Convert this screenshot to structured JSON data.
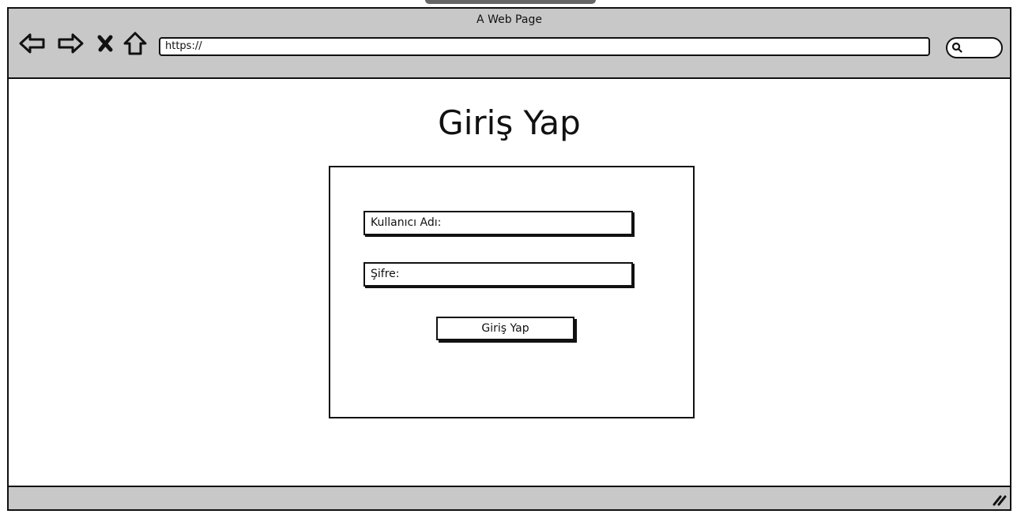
{
  "window": {
    "title": "A Web Page"
  },
  "toolbar": {
    "icons": [
      "back-arrow-icon",
      "forward-arrow-icon",
      "close-x-icon",
      "home-icon"
    ],
    "url": "https://",
    "search_icon": "search-icon"
  },
  "page": {
    "heading": "Giriş Yap"
  },
  "login_form": {
    "username_label": "Kullanıcı Adı:",
    "password_label": "Şifre:",
    "submit_label": "Giriş Yap"
  },
  "statusbar": {
    "resize_icon": "resize-grip-icon"
  }
}
